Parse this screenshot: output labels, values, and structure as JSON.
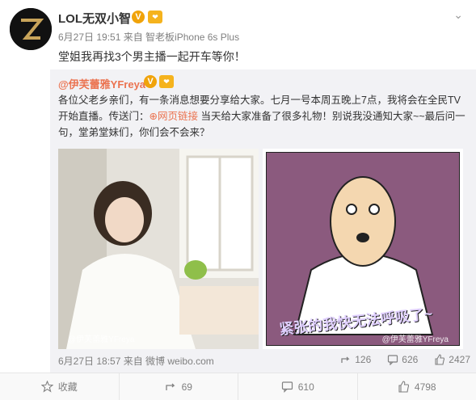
{
  "post": {
    "author_name": "LOL无双小智",
    "meta": "6月27日 19:51 来自 智老板iPhone 6s Plus",
    "text": "堂姐我再找3个男主播一起开车等你！"
  },
  "repost": {
    "author": "@伊芙蕾雅YFreya",
    "text_before_link": "各位父老乡亲们，有一条消息想要分享给大家。七月一号本周五晚上7点，我将会在全民TV开始直播。传送门：",
    "link_label": "网页链接",
    "text_after_link": " 当天给大家准备了很多礼物！别说我没通知大家~~最后问一句，堂弟堂妹们，你们会不会来？",
    "image_left_watermark": "@伊芙蕾雅YFreya",
    "image_right_caption": "紧张的我快无法呼吸了~",
    "image_right_watermark": "@伊芙蕾雅YFreya",
    "date": "6月27日 18:57 来自 微博 weibo.com",
    "reposts": "126",
    "comments": "626",
    "likes": "2427"
  },
  "actions": {
    "collect_label": "收藏",
    "repost_count": "69",
    "comment_count": "610",
    "like_count": "4798"
  },
  "colors": {
    "accent": "#eb7350",
    "repost_bg": "#f2f2f5",
    "meta_gray": "#808080"
  }
}
